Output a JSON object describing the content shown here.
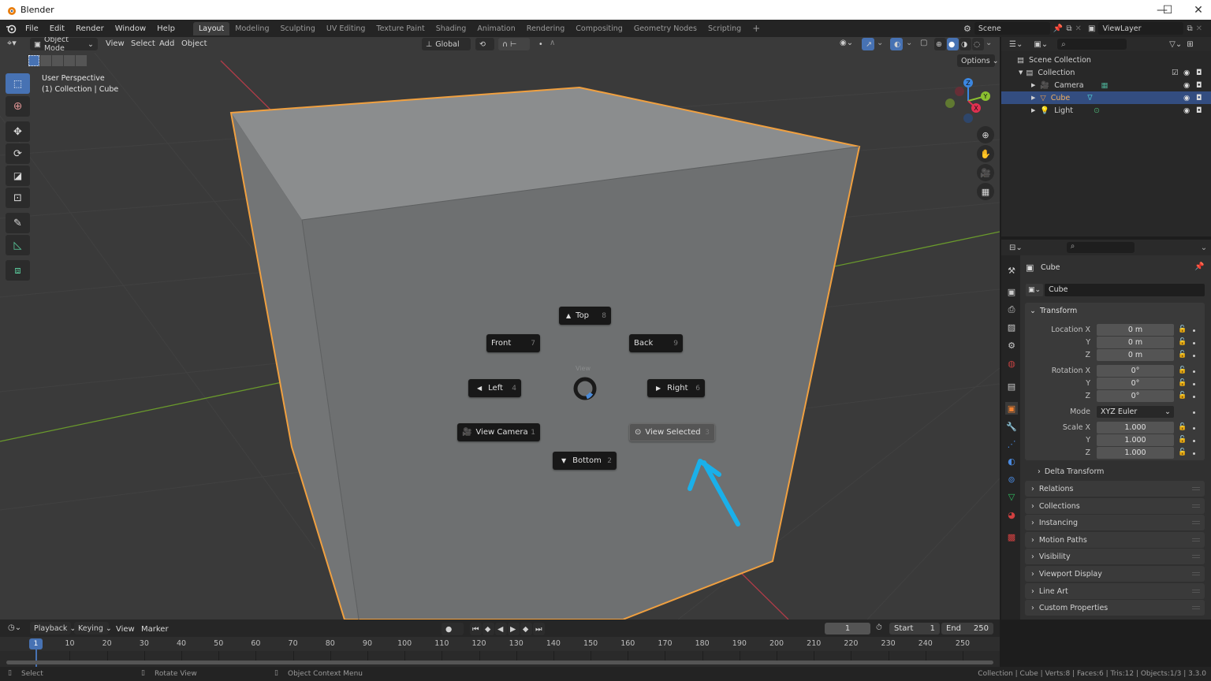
{
  "window": {
    "title": "Blender",
    "controls": {
      "minimize": "—",
      "maximize": "☐",
      "close": "✕"
    }
  },
  "topbar": {
    "menus": [
      "File",
      "Edit",
      "Render",
      "Window",
      "Help"
    ],
    "workspaces": [
      {
        "label": "Layout",
        "active": true
      },
      {
        "label": "Modeling"
      },
      {
        "label": "Sculpting"
      },
      {
        "label": "UV Editing"
      },
      {
        "label": "Texture Paint"
      },
      {
        "label": "Shading"
      },
      {
        "label": "Animation"
      },
      {
        "label": "Rendering"
      },
      {
        "label": "Compositing"
      },
      {
        "label": "Geometry Nodes"
      },
      {
        "label": "Scripting"
      }
    ],
    "add_workspace": "+",
    "scene": "Scene",
    "view_layer": "ViewLayer"
  },
  "viewport_header": {
    "mode": "Object Mode",
    "menus": [
      "View",
      "Select",
      "Add",
      "Object"
    ],
    "orientation": "Global",
    "options_label": "Options"
  },
  "viewport": {
    "view_name": "User Perspective",
    "collection_info": "(1) Collection | Cube",
    "gizmo_axes": [
      "Z",
      "Y",
      "X"
    ],
    "pie_menu": {
      "title": "View",
      "items": [
        {
          "label": "Top",
          "key": "8",
          "icon": "▲"
        },
        {
          "label": "Front",
          "key": "7"
        },
        {
          "label": "Back",
          "key": "9"
        },
        {
          "label": "Left",
          "key": "4",
          "icon": "◀"
        },
        {
          "label": "Right",
          "key": "6",
          "icon": "▶"
        },
        {
          "label": "View Camera",
          "key": "1"
        },
        {
          "label": "View Selected",
          "key": "3",
          "highlighted": true
        },
        {
          "label": "Bottom",
          "key": "2",
          "icon": "▼"
        }
      ]
    },
    "colors": {
      "selection_outline": "#f0a040",
      "annotation_arrow": "#1ab0ea",
      "x_axis": "#b03c48",
      "y_axis": "#6a9a2c"
    }
  },
  "outliner": {
    "root": "Scene Collection",
    "collection": "Collection",
    "items": [
      {
        "name": "Camera",
        "selected": false
      },
      {
        "name": "Cube",
        "selected": true
      },
      {
        "name": "Light",
        "selected": false
      }
    ]
  },
  "properties": {
    "object_name_header": "Cube",
    "object_name_field": "Cube",
    "transform": {
      "title": "Transform",
      "location": {
        "label": "Location X",
        "x": "0 m",
        "y": "0 m",
        "z": "0 m"
      },
      "rotation": {
        "label": "Rotation X",
        "x": "0°",
        "y": "0°",
        "z": "0°"
      },
      "mode_label": "Mode",
      "mode_value": "XYZ Euler",
      "scale": {
        "label": "Scale X",
        "x": "1.000",
        "y": "1.000",
        "z": "1.000"
      },
      "axis_y": "Y",
      "axis_z": "Z"
    },
    "delta_transform": "Delta Transform",
    "panels": [
      "Relations",
      "Collections",
      "Instancing",
      "Motion Paths",
      "Visibility",
      "Viewport Display",
      "Line Art",
      "Custom Properties"
    ]
  },
  "timeline": {
    "menus": [
      "Playback",
      "Keying",
      "View",
      "Marker"
    ],
    "current_frame": "1",
    "start_label": "Start",
    "start_value": "1",
    "end_label": "End",
    "end_value": "250",
    "playhead": "1",
    "ticks": [
      "10",
      "20",
      "30",
      "40",
      "50",
      "60",
      "70",
      "80",
      "90",
      "100",
      "110",
      "120",
      "130",
      "140",
      "150",
      "160",
      "170",
      "180",
      "190",
      "200",
      "210",
      "220",
      "230",
      "240",
      "250"
    ]
  },
  "statusbar": {
    "hints": [
      "Select",
      "Rotate View",
      "Object Context Menu"
    ],
    "stats": "Collection | Cube | Verts:8 | Faces:6 | Tris:12 | Objects:1/3 | 3.3.0"
  }
}
